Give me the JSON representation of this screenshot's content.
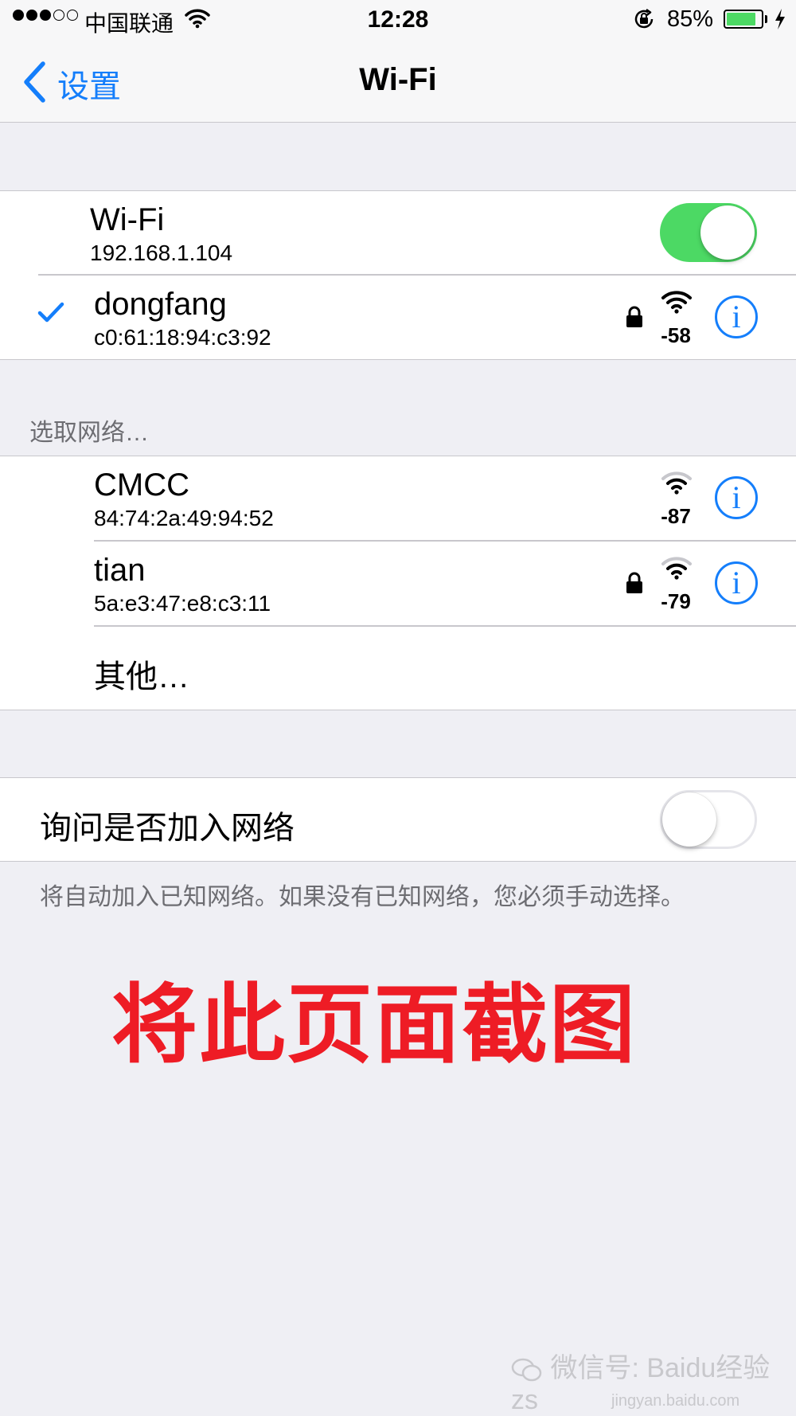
{
  "status_bar": {
    "carrier": "中国联通",
    "time": "12:28",
    "battery_percent": "85%",
    "battery_level": 0.85,
    "signal_bars_filled": 3,
    "signal_bars_total": 5
  },
  "nav": {
    "back_label": "设置",
    "title": "Wi-Fi"
  },
  "wifi_toggle": {
    "label": "Wi-Fi",
    "ip": "192.168.1.104",
    "enabled": true
  },
  "connected_network": {
    "name": "dongfang",
    "mac": "c0:61:18:94:c3:92",
    "rssi": "-58",
    "secured": true,
    "checked": true
  },
  "choose_header": "选取网络…",
  "networks": [
    {
      "name": "CMCC",
      "mac": "84:74:2a:49:94:52",
      "rssi": "-87",
      "secured": false
    },
    {
      "name": "tian",
      "mac": "5a:e3:47:e8:c3:11",
      "rssi": "-79",
      "secured": true
    }
  ],
  "other_label": "其他…",
  "ask_join": {
    "label": "询问是否加入网络",
    "enabled": false
  },
  "ask_join_note": "将自动加入已知网络。如果没有已知网络，您必须手动选择。",
  "annotation": "将此页面截图",
  "watermark": {
    "text": "微信号: Baidu经验 zs",
    "sub": "jingyan.baidu.com"
  },
  "colors": {
    "accent": "#147efb",
    "switch_on": "#4cd964",
    "annotation": "#ee1c25",
    "background": "#efeff4"
  }
}
